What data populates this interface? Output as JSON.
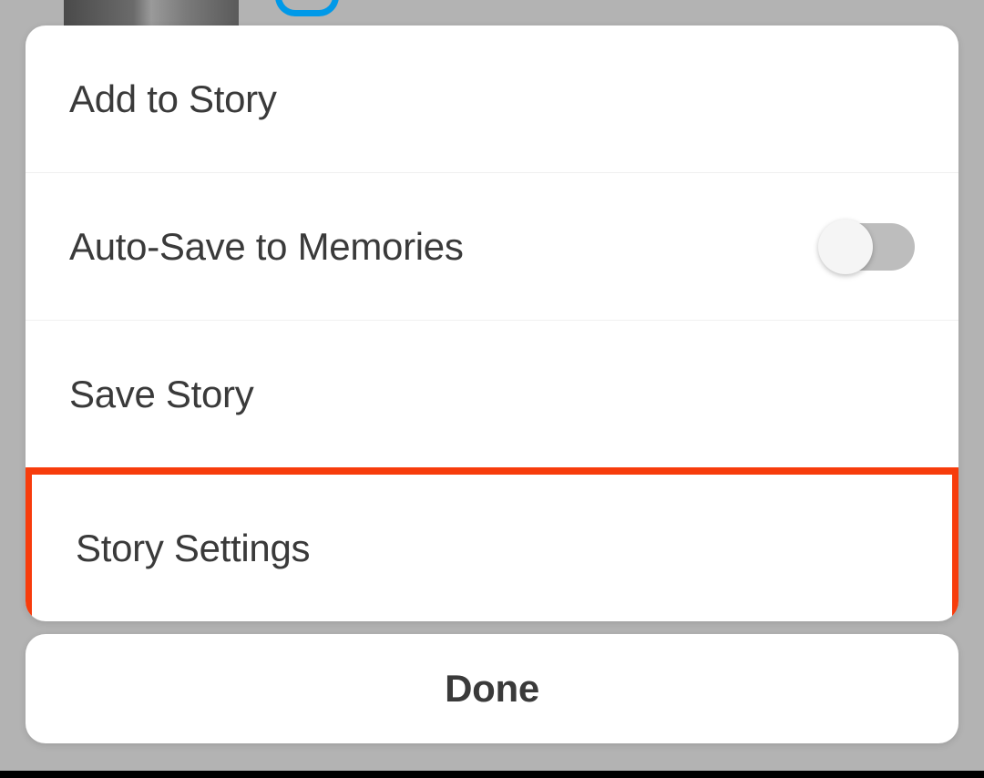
{
  "menu": {
    "items": [
      {
        "label": "Add to Story",
        "has_toggle": false
      },
      {
        "label": "Auto-Save to Memories",
        "has_toggle": true,
        "toggle_state": "off"
      },
      {
        "label": "Save Story",
        "has_toggle": false
      },
      {
        "label": "Story Settings",
        "has_toggle": false,
        "highlighted": true
      }
    ]
  },
  "done_button": {
    "label": "Done"
  },
  "colors": {
    "highlight_border": "#f73c0c",
    "toggle_off": "#bdbdbd",
    "icon_accent": "#0099e8"
  }
}
